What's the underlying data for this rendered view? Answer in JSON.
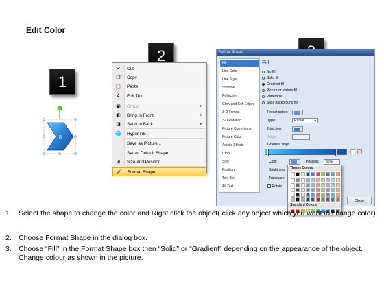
{
  "page": {
    "title": "Edit Color"
  },
  "steps": {
    "s1": "1",
    "s2": "2",
    "s3": "3"
  },
  "shape": {
    "label": "8",
    "fill_color": "#2a7fd0"
  },
  "context_menu": {
    "items": [
      {
        "label": "Cut",
        "icon": "scissors-icon",
        "glyph": "✂",
        "disabled": false,
        "submenu": false,
        "highlight": false
      },
      {
        "label": "Copy",
        "icon": "copy-icon",
        "glyph": "❐",
        "disabled": false,
        "submenu": false,
        "highlight": false
      },
      {
        "label": "Paste",
        "icon": "paste-icon",
        "glyph": "📋",
        "disabled": false,
        "submenu": false,
        "highlight": false
      },
      {
        "label": "Edit Text",
        "icon": "edit-text-icon",
        "glyph": "A",
        "disabled": false,
        "submenu": false,
        "highlight": false
      },
      {
        "label": "Group",
        "icon": "group-icon",
        "glyph": "▣",
        "disabled": true,
        "submenu": true,
        "highlight": false
      },
      {
        "label": "Bring to Front",
        "icon": "bring-front-icon",
        "glyph": "◧",
        "disabled": false,
        "submenu": true,
        "highlight": false
      },
      {
        "label": "Send to Back",
        "icon": "send-back-icon",
        "glyph": "◨",
        "disabled": false,
        "submenu": true,
        "highlight": false
      },
      {
        "label": "Hyperlink...",
        "icon": "hyperlink-icon",
        "glyph": "🌐",
        "disabled": false,
        "submenu": false,
        "highlight": false
      },
      {
        "label": "Save as Picture...",
        "icon": "",
        "glyph": "",
        "disabled": false,
        "submenu": false,
        "highlight": false
      },
      {
        "label": "Set as Default Shape",
        "icon": "",
        "glyph": "",
        "disabled": false,
        "submenu": false,
        "highlight": false
      },
      {
        "label": "Size and Position...",
        "icon": "size-position-icon",
        "glyph": "⊞",
        "disabled": false,
        "submenu": false,
        "highlight": false
      },
      {
        "label": "Format Shape...",
        "icon": "format-shape-icon",
        "glyph": "🖌",
        "disabled": false,
        "submenu": false,
        "highlight": true
      }
    ],
    "submenu_arrow": "▸"
  },
  "dialog": {
    "title": "Format Shape",
    "categories": [
      "Fill",
      "Line Color",
      "Line Style",
      "Shadow",
      "Reflection",
      "Glow and Soft Edges",
      "3-D Format",
      "3-D Rotation",
      "Picture Corrections",
      "Picture Color",
      "Artistic Effects",
      "Crop",
      "Size",
      "Position",
      "Text Box",
      "Alt Text"
    ],
    "selected_category": "Fill",
    "fill": {
      "heading": "Fill",
      "options": [
        {
          "label": "No fill",
          "checked": false
        },
        {
          "label": "Solid fill",
          "checked": false
        },
        {
          "label": "Gradient fill",
          "checked": true
        },
        {
          "label": "Picture or texture fill",
          "checked": false
        },
        {
          "label": "Pattern fill",
          "checked": false
        },
        {
          "label": "Slide background fill",
          "checked": false
        }
      ],
      "preset_colors_label": "Preset colors:",
      "type_label": "Type:",
      "type_value": "Radial",
      "direction_label": "Direction:",
      "angle_label": "Angle:",
      "gradient_stops_label": "Gradient stops",
      "color_label": "Color",
      "position_label": "Position:",
      "position_value": "85%",
      "brightness_label": "Brightness",
      "transparency_label": "Transpare",
      "rotate_label": "Rotate"
    },
    "close_label": "Close"
  },
  "color_picker": {
    "theme_label": "Theme Colors",
    "standard_label": "Standard Colors",
    "theme_top": [
      "#ffffff",
      "#000000",
      "#eeece1",
      "#1f497d",
      "#4f81bd",
      "#c0504d",
      "#9bbb59",
      "#8064a2",
      "#4bacc6",
      "#f79646"
    ],
    "standard": [
      "#c00000",
      "#ff0000",
      "#ffc000",
      "#ffff00",
      "#92d050",
      "#00b050",
      "#00b0f0",
      "#0070c0",
      "#002060",
      "#7030a0"
    ]
  },
  "instructions": [
    {
      "num": "1.",
      "text": "Select the shape to change the color and Right click the object( click any object which you want to change color)"
    },
    {
      "num": "2.",
      "text": "Choose Format Shape in the dialog box."
    },
    {
      "num": "3.",
      "text": "Choose “Fill” in the Format Shape box then “Solid” or “Gradient” depending on the appearance of the object. Change colour as shown in the picture."
    }
  ]
}
